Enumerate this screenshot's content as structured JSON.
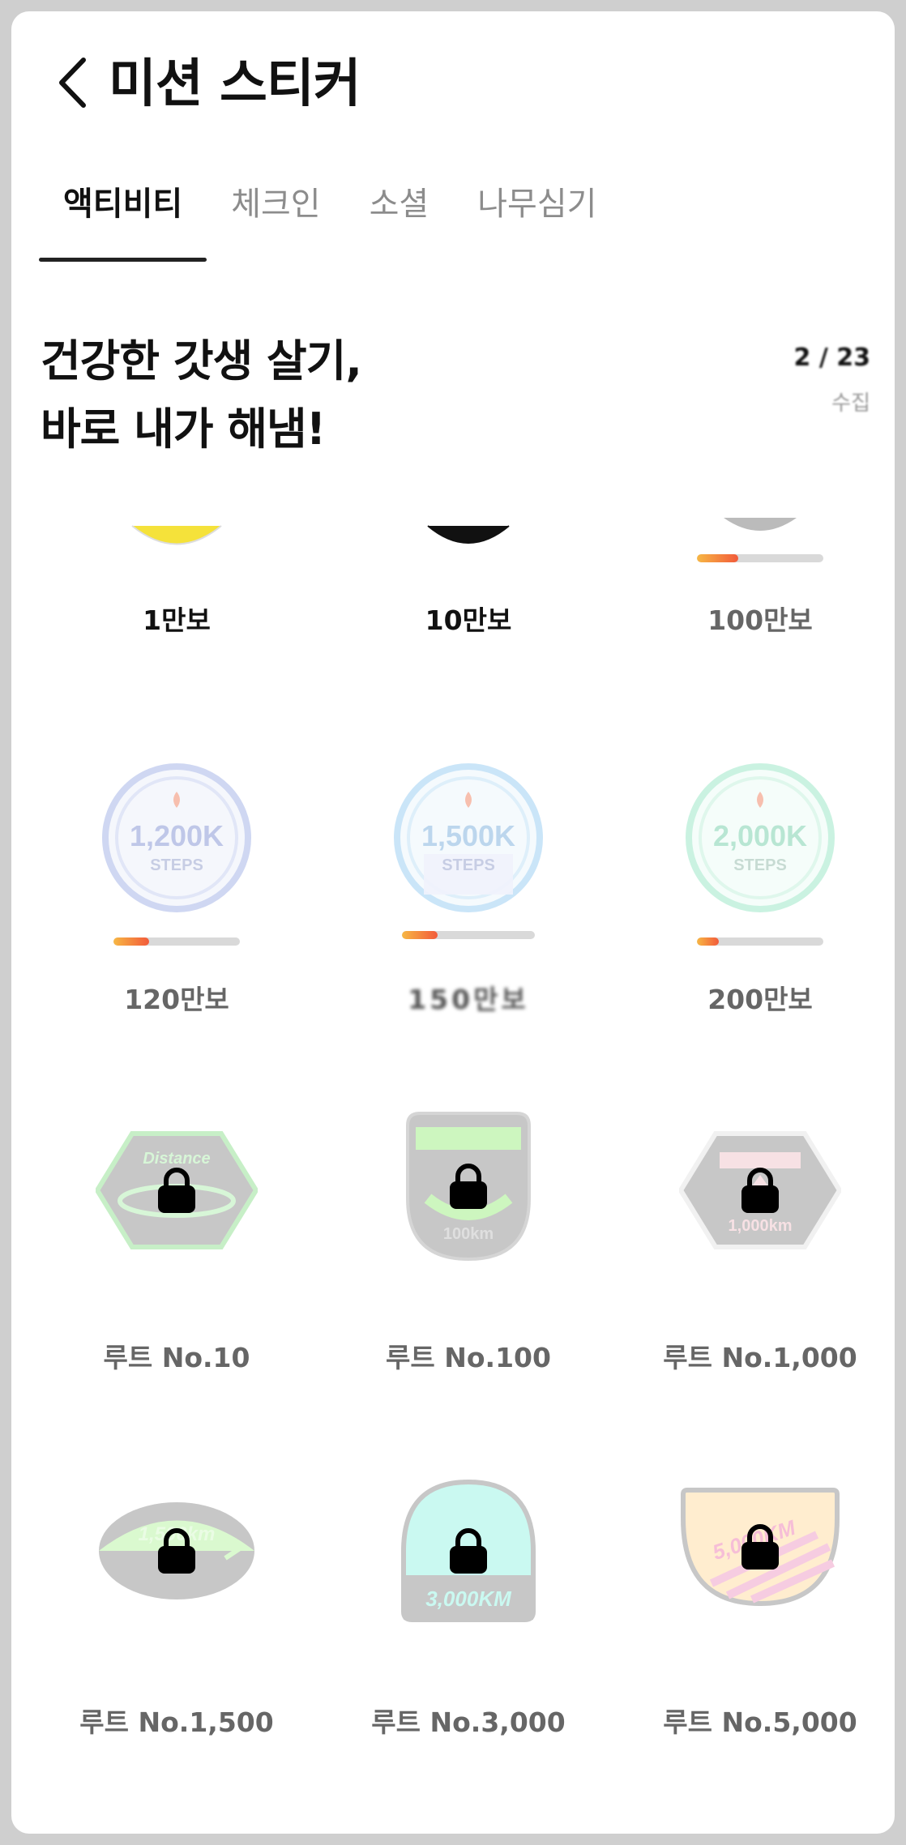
{
  "header": {
    "title": "미션 스티커"
  },
  "tabs": [
    {
      "label": "액티비티",
      "active": true
    },
    {
      "label": "체크인",
      "active": false
    },
    {
      "label": "소셜",
      "active": false
    },
    {
      "label": "나무심기",
      "active": false
    }
  ],
  "headline": {
    "line1": "건강한 갓생 살기,",
    "line2": "바로 내가 해냄!"
  },
  "stat": {
    "value": "2 / 23",
    "label": "수집"
  },
  "stickers": [
    {
      "label": "1만보",
      "state": "done"
    },
    {
      "label": "10만보",
      "state": "done"
    },
    {
      "label": "100만보",
      "state": "progress",
      "progress": 0.33
    },
    {
      "label": "120만보",
      "state": "progress",
      "progress": 0.28,
      "badge_text": "1,200K",
      "badge_sub": "STEPS",
      "color": "#a9b8e8"
    },
    {
      "label": "150만보",
      "state": "progress",
      "progress": 0.27,
      "badge_text": "1,500K",
      "badge_sub": "STEPS",
      "color": "#9fd0f3"
    },
    {
      "label": "200만보",
      "state": "progress",
      "progress": 0.17,
      "badge_text": "2,000K",
      "badge_sub": "STEPS",
      "color": "#9fe8c9"
    },
    {
      "label": "루트 No.10",
      "state": "locked",
      "badge_text": "Distance",
      "color": "#9be39b"
    },
    {
      "label": "루트 No.100",
      "state": "locked",
      "badge_text": "100km",
      "color": "#a6f08c"
    },
    {
      "label": "루트 No.1,000",
      "state": "locked",
      "badge_text": "1,000km",
      "color": "#f2c9cf"
    },
    {
      "label": "루트 No.1,500",
      "state": "locked",
      "badge_text": "1,500km",
      "color": "#bdf5a8"
    },
    {
      "label": "루트 No.3,000",
      "state": "locked",
      "badge_text": "3,000KM",
      "color": "#9ff5e6"
    },
    {
      "label": "루트 No.5,000",
      "state": "locked",
      "badge_text": "5,000KM",
      "color": "#ffe0a8"
    }
  ]
}
